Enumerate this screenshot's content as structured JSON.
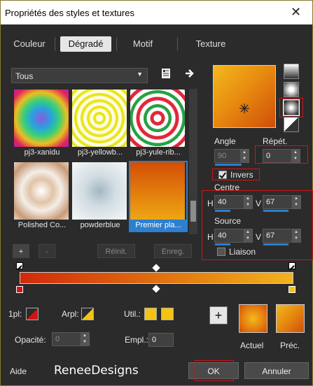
{
  "window": {
    "title": "Propriétés des styles et textures",
    "close_glyph": "✕"
  },
  "tabs": [
    {
      "label": "Couleur"
    },
    {
      "label": "Dégradé",
      "active": true
    },
    {
      "label": "Motif"
    },
    {
      "label": "Texture"
    }
  ],
  "category": {
    "value": "Tous"
  },
  "swatches": [
    {
      "label": "pj3-xanidu"
    },
    {
      "label": "pj3-yellowb..."
    },
    {
      "label": "pj3-yule-rib..."
    },
    {
      "label": "Polished Co..."
    },
    {
      "label": "powderblue"
    },
    {
      "label": "Premier pla...",
      "selected": true
    }
  ],
  "list_buttons": {
    "add": "+",
    "remove": "-",
    "reset": "Réinit.",
    "save": "Enreg."
  },
  "angle": {
    "label": "Angle",
    "value": "90"
  },
  "repeat": {
    "label": "Répét.",
    "value": "0"
  },
  "invert": {
    "label": "Invers",
    "checked": true
  },
  "center": {
    "label": "Centre",
    "h_label": "H",
    "h": "40",
    "v_label": "V",
    "v": "67"
  },
  "source": {
    "label": "Source",
    "h_label": "H",
    "h": "40",
    "v_label": "V",
    "v": "67"
  },
  "link": {
    "label": "Liaison",
    "checked": false
  },
  "stops": {
    "first_label": "1pl:",
    "back_label": "Arpl:",
    "user_label": "Util.:",
    "opacity_label": "Opacité:",
    "opacity_value": "0",
    "location_label": "Empl.:",
    "location_value": "0",
    "user_colors": [
      "#f2c417",
      "#f2c417"
    ]
  },
  "previews": {
    "add_glyph": "+",
    "current_label": "Actuel",
    "previous_label": "Préc."
  },
  "footer": {
    "help": "Aide",
    "watermark": "ReneeDesigns",
    "ok": "OK",
    "cancel": "Annuler"
  },
  "colors": {
    "accent_blue": "#2d7fd0",
    "highlight_red": "#d21414",
    "gradient_start": "#d02a0c",
    "gradient_end": "#f2b320"
  }
}
